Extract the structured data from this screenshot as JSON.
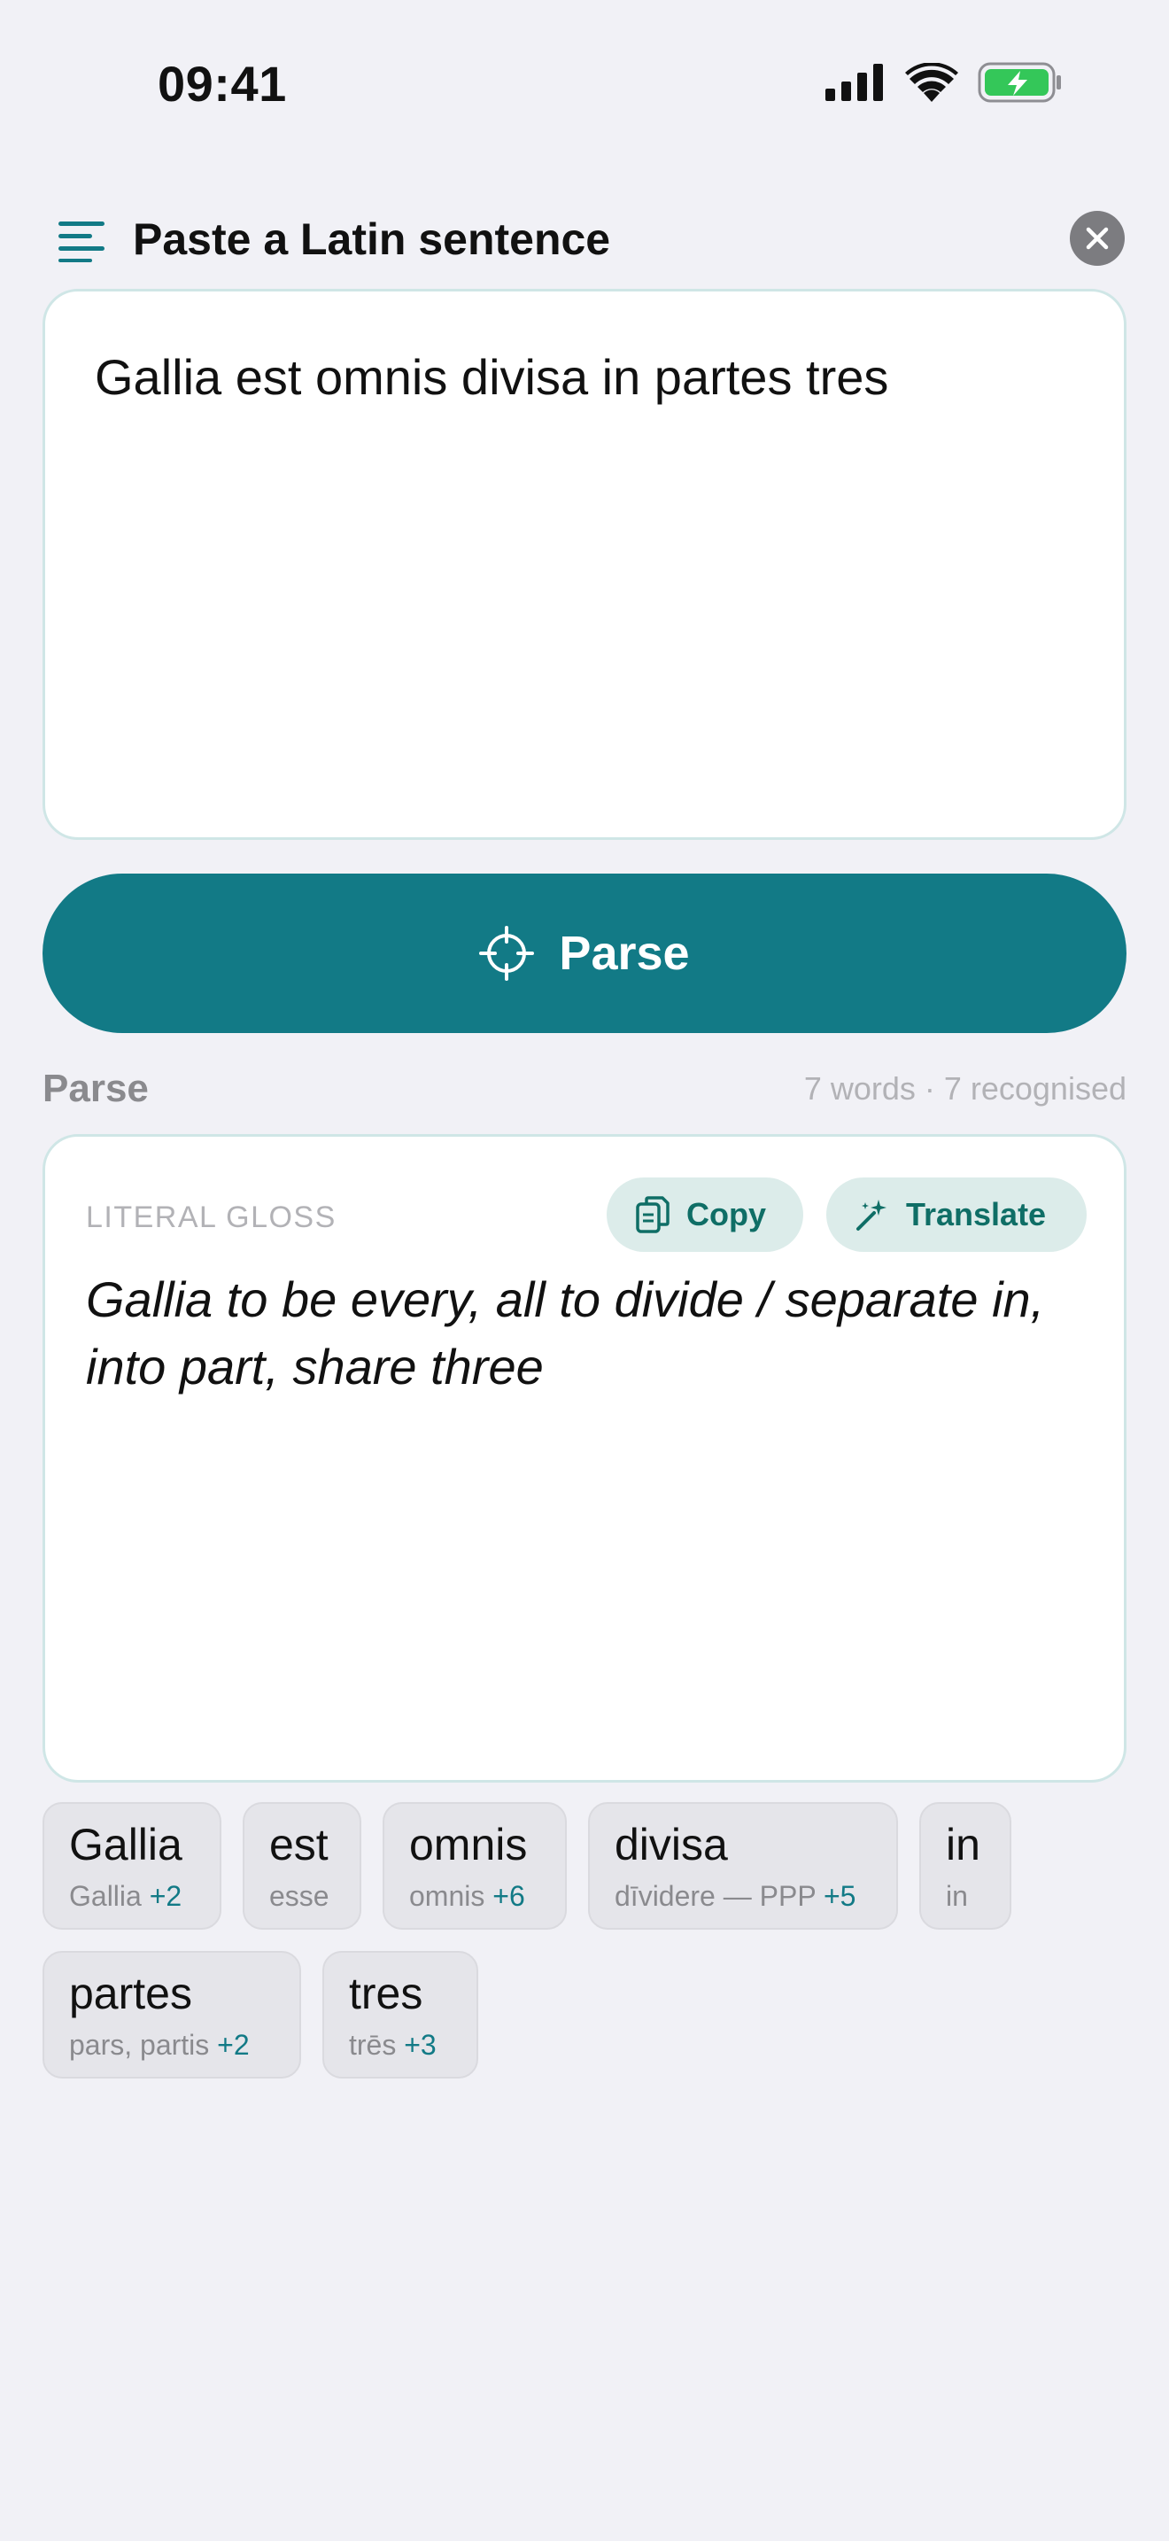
{
  "status": {
    "time": "09:41"
  },
  "header": {
    "title": "Paste a Latin sentence"
  },
  "input": {
    "value": "Gallia est omnis divisa in partes tres"
  },
  "parse_button": {
    "label": "Parse"
  },
  "section": {
    "title": "Parse",
    "meta": "7 words · 7 recognised"
  },
  "gloss": {
    "label": "LITERAL GLOSS",
    "copy_label": "Copy",
    "translate_label": "Translate",
    "text": "Gallia to be every, all to divide / separate in, into part, share three"
  },
  "tokens": [
    {
      "word": "Gallia",
      "lemma": "Gallia",
      "more": "+2"
    },
    {
      "word": "est",
      "lemma": "esse",
      "more": ""
    },
    {
      "word": "omnis",
      "lemma": "omnis",
      "more": "+6"
    },
    {
      "word": "divisa",
      "lemma": "dīvidere — PPP",
      "more": "+5"
    },
    {
      "word": "in",
      "lemma": "in",
      "more": ""
    },
    {
      "word": "partes",
      "lemma": "pars, partis",
      "more": "+2"
    },
    {
      "word": "tres",
      "lemma": "trēs",
      "more": "+3"
    }
  ],
  "colors": {
    "accent": "#127a86",
    "chip_bg": "#dcecea",
    "battery": "#34c759"
  }
}
